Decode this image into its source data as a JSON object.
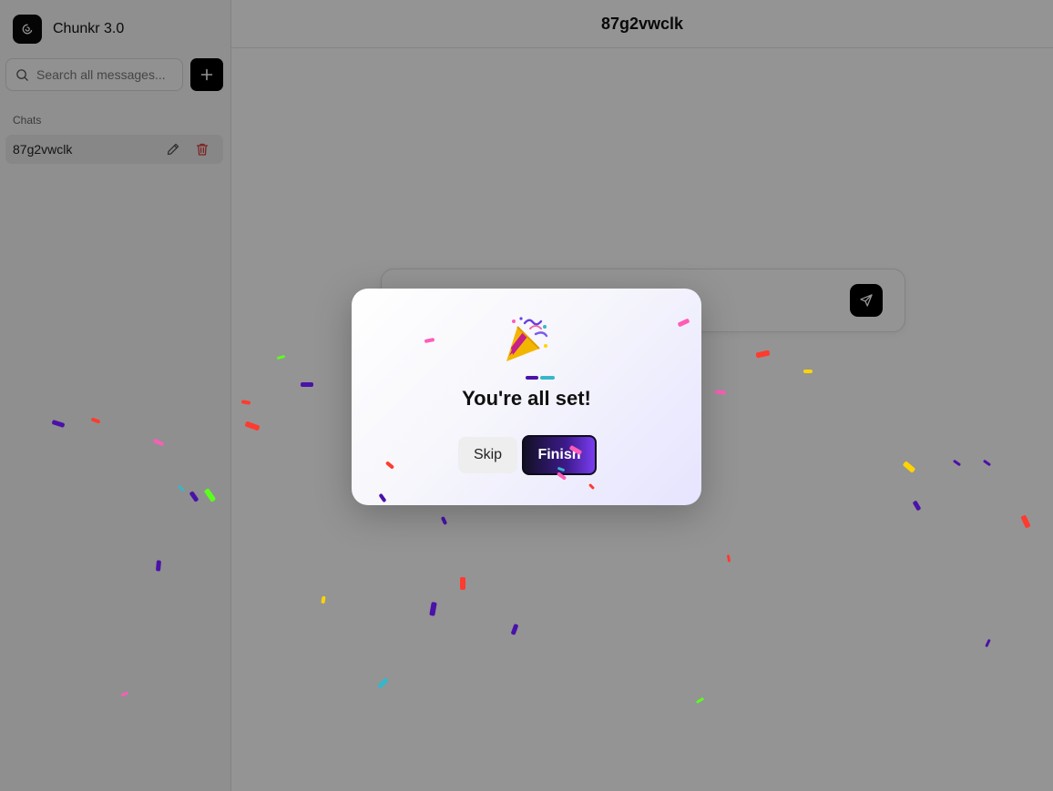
{
  "app": {
    "name": "Chunkr 3.0"
  },
  "sidebar": {
    "search_placeholder": "Search all messages...",
    "section_label": "Chats",
    "chats": [
      {
        "label": "87g2vwclk"
      }
    ]
  },
  "main": {
    "title": "87g2vwclk"
  },
  "modal": {
    "title": "You're all set!",
    "skip_label": "Skip",
    "finish_label": "Finish"
  },
  "icons": {
    "brand": "spiral-logo-icon",
    "search": "search-icon",
    "new_chat": "plus-icon",
    "rename": "pencil-icon",
    "delete": "trash-icon",
    "send": "send-icon",
    "celebration": "party-popper-icon"
  },
  "colors": {
    "brand_black": "#000000",
    "delete_red": "#d93a3a",
    "finish_gradient_end": "#7a3df0",
    "confetti": [
      "#4a12a8",
      "#ff3b2f",
      "#ff5cb8",
      "#38b6c9",
      "#ffd400",
      "#5aff1e"
    ]
  }
}
